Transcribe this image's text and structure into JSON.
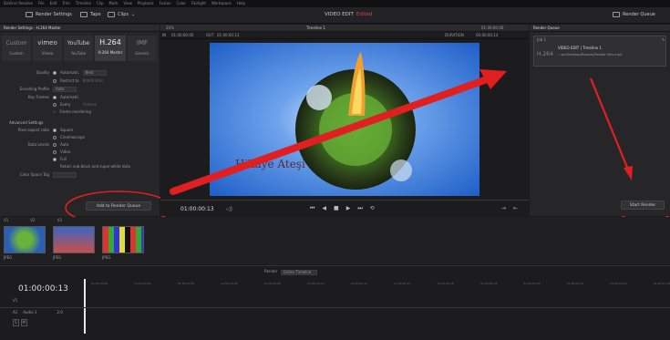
{
  "menu": [
    "DaVinci Resolve",
    "File",
    "Edit",
    "Trim",
    "Timeline",
    "Clip",
    "Mark",
    "View",
    "Playback",
    "Fusion",
    "Color",
    "Fairlight",
    "Workspace",
    "Help"
  ],
  "topbar": {
    "render_settings": "Render Settings",
    "tape": "Tape",
    "clips": "Clips",
    "project": "VIDEO EDIT",
    "status": "Edited",
    "render_queue": "Render Queue"
  },
  "render_settings": {
    "title": "Render Settings - H.264 Master",
    "presets": [
      {
        "label": "Custom",
        "logo": "Custom"
      },
      {
        "label": "Vimeo",
        "logo": "vimeo"
      },
      {
        "label": "YouTube",
        "logo": "YouTube"
      },
      {
        "label": "H.264 Master",
        "logo": "H.264"
      },
      {
        "label": "Generic",
        "logo": "IMF"
      }
    ],
    "rows": [
      {
        "label": "Quality",
        "value": "Automatic",
        "extra": "Best"
      },
      {
        "label": "",
        "value": "Restrict to",
        "extra": "80000 Kb/s"
      },
      {
        "label": "Encoding Profile",
        "value": "Auto",
        "extra": ""
      },
      {
        "label": "Key Frames",
        "value": "Automatic",
        "extra": ""
      },
      {
        "label": "",
        "value": "Every",
        "extra": "Frames"
      },
      {
        "label": "",
        "value": "Frame reordering",
        "extra": ""
      }
    ],
    "advanced": "Advanced Settings",
    "pixel_aspect": "Pixel aspect ratio",
    "pa_opts": [
      "Square",
      "Cinemascope"
    ],
    "data_levels": "Data Levels",
    "dl_opts": [
      "Auto",
      "Video",
      "Full"
    ],
    "retain": "Retain sub-black and super-white data",
    "color_space": "Color Space Tag",
    "add_queue": "Add to Render Queue"
  },
  "viewer": {
    "zoom": "20%",
    "timeline": "Timeline 1",
    "tc_right": "01:00:00:00",
    "in_label": "IN",
    "in_tc": "01:00:00:00",
    "out_label": "OUT",
    "out_tc": "01:00:00:13",
    "duration_label": "DURATION",
    "duration": "00:00:00:14",
    "watermark": "Hikaye Ateşi",
    "timecode": "01:00:00:13"
  },
  "queue": {
    "title": "Render Queue",
    "job": "Job 1",
    "format": "H.264",
    "job_title": "VIDEO EDIT | Timeline 1",
    "path": "...ser/Desktop/Masalar/Render files.mp4",
    "start": "Start Render"
  },
  "media": {
    "v1": "V1",
    "v2": "V2",
    "v3": "V3",
    "clips": [
      {
        "name": "JPEG"
      },
      {
        "name": "JPEG"
      },
      {
        "name": "JPEG"
      }
    ]
  },
  "timeline": {
    "tc": "01:00:00:13",
    "render_label": "Render",
    "render_value": "Entire Timeline",
    "track_v1": "V1",
    "track_a1": "A1",
    "audio1": "Audio 1",
    "a_level": "2.0",
    "ruler": [
      "01:00:00:00",
      "01:00:00:02",
      "01:00:00:04",
      "01:00:00:06",
      "01:00:00:08",
      "01:00:00:10",
      "01:00:00:12",
      "01:00:00:14",
      "01:00:00:16",
      "01:00:00:18",
      "01:00:00:20",
      "01:00:00:22",
      "01:00:00:24",
      "01:00:01:00"
    ]
  },
  "colors": {
    "accent": "#d8423b",
    "arrow": "#e02020",
    "panel": "#262628"
  }
}
